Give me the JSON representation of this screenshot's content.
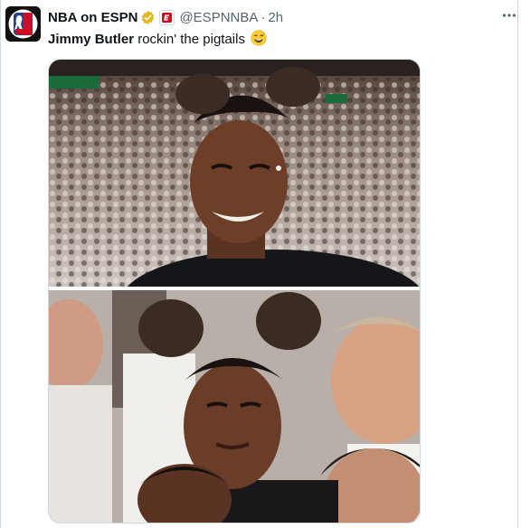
{
  "post": {
    "display_name": "NBA on ESPN",
    "handle": "@ESPNNBA",
    "separator": "·",
    "time": "2h",
    "text_bold": "Jimmy Butler",
    "text_rest": " rockin' the pigtails",
    "emoji": "😅"
  },
  "avatar": {
    "label": "NBA ESPN"
  },
  "colors": {
    "verified_gold": "#e2b719",
    "espn_red": "#d00a1e",
    "secondary_text": "#536471"
  },
  "icons": {
    "verified": "gold-verified-badge-icon",
    "affiliate": "espn-affiliate-badge-icon",
    "more": "more-options-icon"
  },
  "media": {
    "photo_1_alt": "Jimmy Butler smiling with pigtails in arena",
    "photo_2_alt": "Jimmy Butler courtside with pigtails"
  }
}
